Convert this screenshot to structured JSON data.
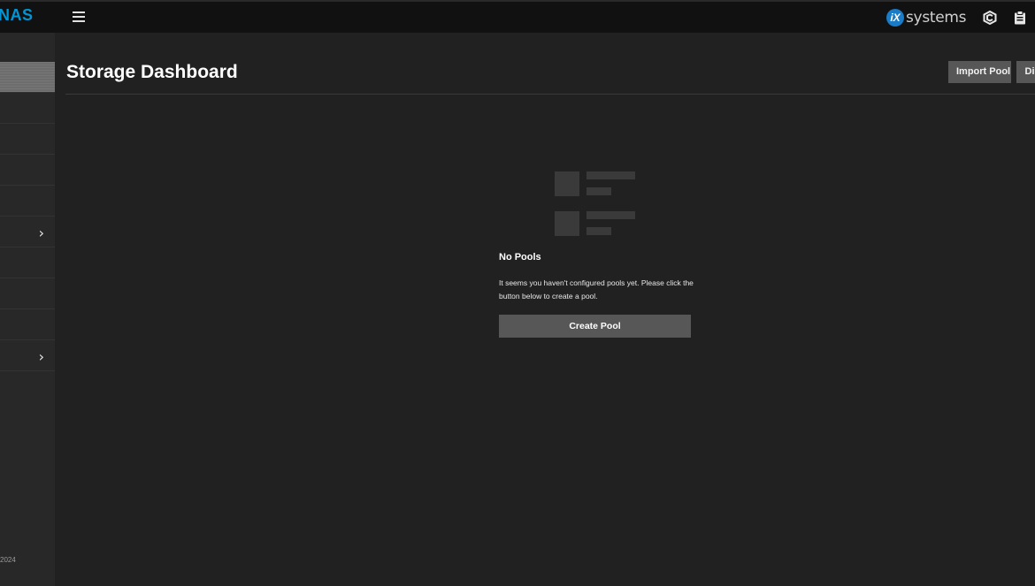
{
  "app": {
    "brand": "NAS",
    "vendor_badge": "iX",
    "vendor_text": "systems"
  },
  "topbar": {
    "menu_icon": "hamburger-icon",
    "icons": [
      "truecommand-icon",
      "clipboard-icon"
    ]
  },
  "sidebar": {
    "items": [
      {
        "name": "sidebar-item-1",
        "active": true
      },
      {
        "name": "sidebar-item-2"
      },
      {
        "name": "sidebar-item-3"
      },
      {
        "name": "sidebar-item-4"
      },
      {
        "name": "sidebar-item-5"
      },
      {
        "name": "sidebar-item-6",
        "expand_icon": "chevron-right-icon",
        "chevron": "›"
      },
      {
        "name": "sidebar-item-7"
      },
      {
        "name": "sidebar-item-8"
      },
      {
        "name": "sidebar-item-9"
      },
      {
        "name": "sidebar-item-10",
        "expand_icon": "chevron-right-icon",
        "chevron": "›"
      }
    ],
    "copyright": "2024"
  },
  "page": {
    "title": "Storage Dashboard",
    "actions": {
      "import_pool": "Import Pool",
      "disks": "Di"
    }
  },
  "empty_state": {
    "icon": "empty-list-icon",
    "title": "No Pools",
    "message": "It seems you haven't configured pools yet. Please click the button below to create a pool.",
    "create_button": "Create Pool"
  },
  "colors": {
    "background": "#212121",
    "topbar": "#111111",
    "sidebar": "#282828",
    "accent": "#0095d5",
    "button": "#575757"
  }
}
